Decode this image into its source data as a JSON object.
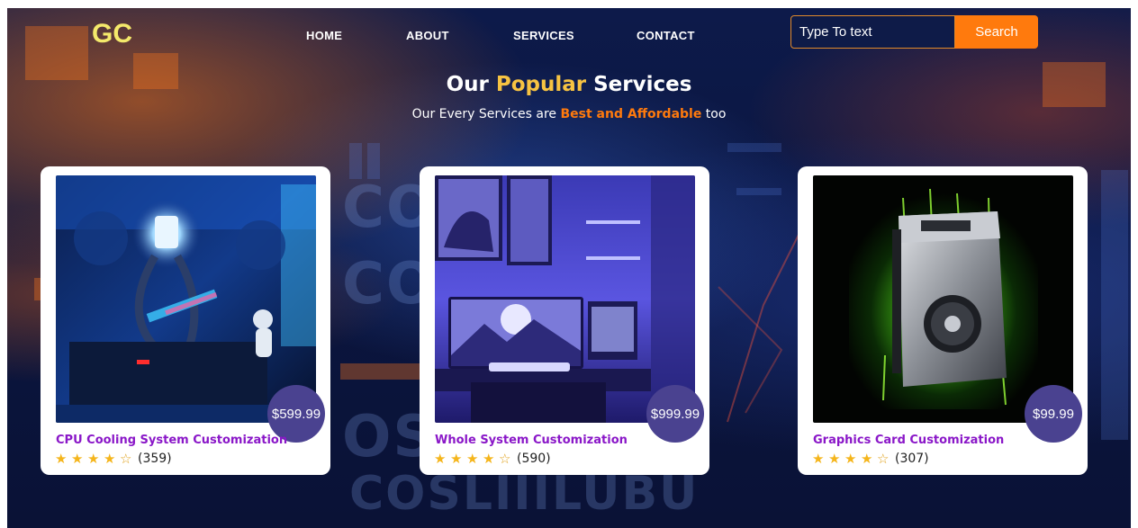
{
  "header": {
    "logo": "GC",
    "nav": [
      {
        "label": "HOME"
      },
      {
        "label": "ABOUT"
      },
      {
        "label": "SERVICES"
      },
      {
        "label": "CONTACT"
      }
    ],
    "search": {
      "placeholder": "Type To text",
      "button_label": "Search"
    }
  },
  "section": {
    "title_part1": "Our ",
    "title_accent": "Popular",
    "title_part2": " Services",
    "subtitle_part1": "Our Every Services are ",
    "subtitle_accent": "Best and Affordable",
    "subtitle_part2": " too"
  },
  "cards": [
    {
      "title": "CPU Cooling System Customization",
      "price": "$599.99",
      "rating": 4,
      "rating_max": 5,
      "reviews": "(359)",
      "image": "pc-cooling-image"
    },
    {
      "title": "Whole System Customization",
      "price": "$999.99",
      "rating": 4,
      "rating_max": 5,
      "reviews": "(590)",
      "image": "desk-setup-image"
    },
    {
      "title": "Graphics Card Customization",
      "price": "$99.99",
      "rating": 4,
      "rating_max": 5,
      "reviews": "(307)",
      "image": "graphics-card-image"
    }
  ],
  "colors": {
    "logo": "#f4e96b",
    "accent_yellow": "#f7c342",
    "accent_orange": "#ff7a0d",
    "price_badge": "#4a4290",
    "card_title": "#8a17c8",
    "star": "#f5b51b"
  }
}
